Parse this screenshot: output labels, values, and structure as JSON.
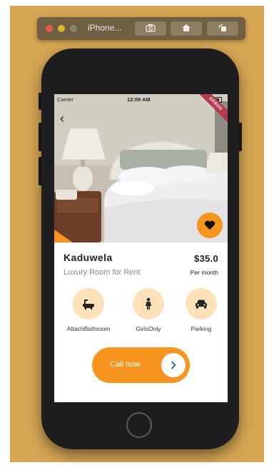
{
  "simulator": {
    "title": "iPhone..."
  },
  "status_bar": {
    "carrier": "Carrier",
    "time": "12:09 AM",
    "debug_label": "DEBUG"
  },
  "listing": {
    "location": "Kaduwela",
    "subtitle": "Luxury Room for Rent",
    "price": "$35.0",
    "price_period": "Per month"
  },
  "amenities": [
    {
      "label": "AttachBathroom",
      "icon": "bathtub-icon"
    },
    {
      "label": "GirlsOnly",
      "icon": "female-icon"
    },
    {
      "label": "Parking",
      "icon": "car-icon"
    }
  ],
  "cta": {
    "label": "Call now"
  },
  "colors": {
    "accent": "#f7941d",
    "accent_light": "#fde1b9",
    "backdrop": "#d4a553"
  }
}
